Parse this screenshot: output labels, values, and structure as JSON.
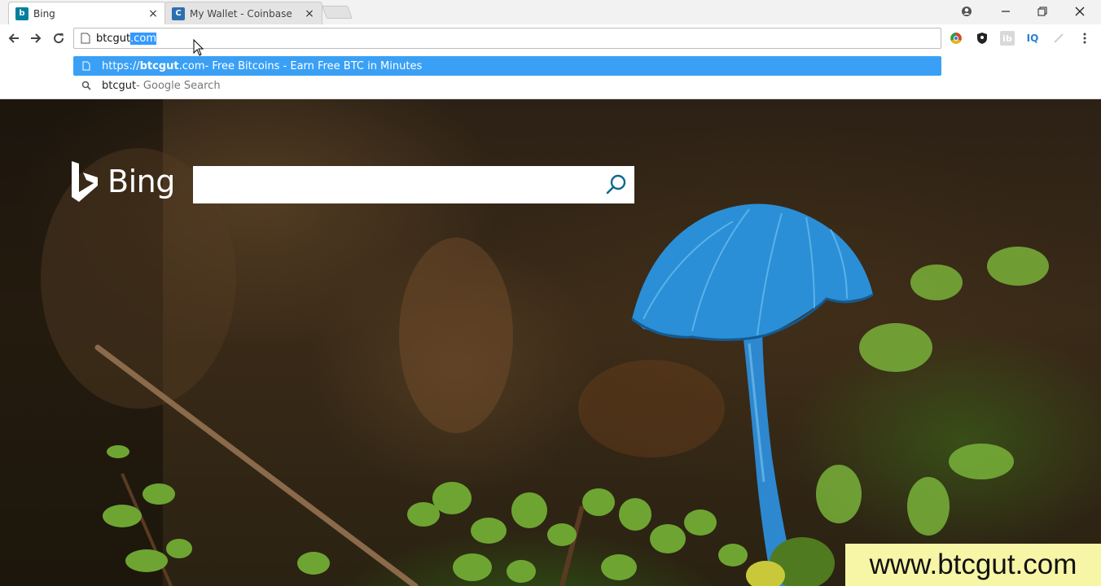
{
  "tabs": [
    {
      "title": "Bing",
      "favicon_color": "#00809d",
      "active": true
    },
    {
      "title": "My Wallet - Coinbase",
      "favicon_color": "#2b71b1",
      "active": false
    }
  ],
  "address_bar": {
    "typed": "btcgut",
    "autocomplete": ".com"
  },
  "suggestions": [
    {
      "prefix": "https://",
      "bold": "btcgut",
      "rest": ".com",
      "desc": " - Free Bitcoins - Earn Free BTC in Minutes",
      "icon": "page-icon"
    },
    {
      "prefix": "",
      "bold": "",
      "rest": "btcgut",
      "desc": " - Google Search",
      "icon": "search-icon"
    }
  ],
  "extensions": [
    "chrome-icon",
    "shield-icon",
    "ib",
    "IQ",
    "wand-icon"
  ],
  "bing": {
    "wordmark": "Bing",
    "search_placeholder": ""
  },
  "watermark": "www.btcgut.com",
  "colors": {
    "selection_blue": "#3aa0f5",
    "bing_search_icon": "#0c6a8f",
    "mushroom_blue": "#2a8fd6",
    "watermark_bg": "#f7f5a6"
  }
}
